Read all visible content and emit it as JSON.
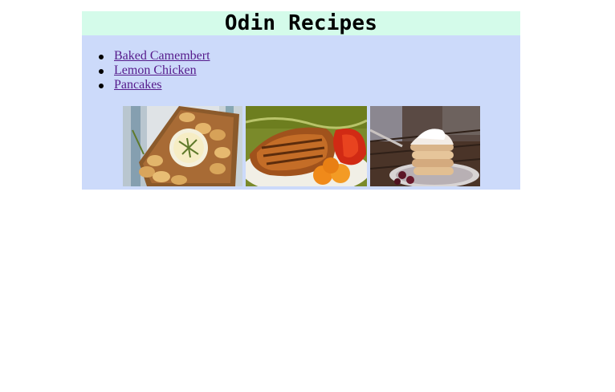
{
  "header": {
    "title": "Odin Recipes",
    "background_color": "#d4fbea"
  },
  "content": {
    "background_color": "#ccdafa",
    "link_color": "#551a8b"
  },
  "recipes": [
    {
      "label": "Baked Camembert"
    },
    {
      "label": "Lemon Chicken"
    },
    {
      "label": "Pancakes"
    }
  ],
  "gallery": [
    {
      "subject": "baked-camembert-photo"
    },
    {
      "subject": "lemon-chicken-photo"
    },
    {
      "subject": "pancakes-photo"
    }
  ]
}
